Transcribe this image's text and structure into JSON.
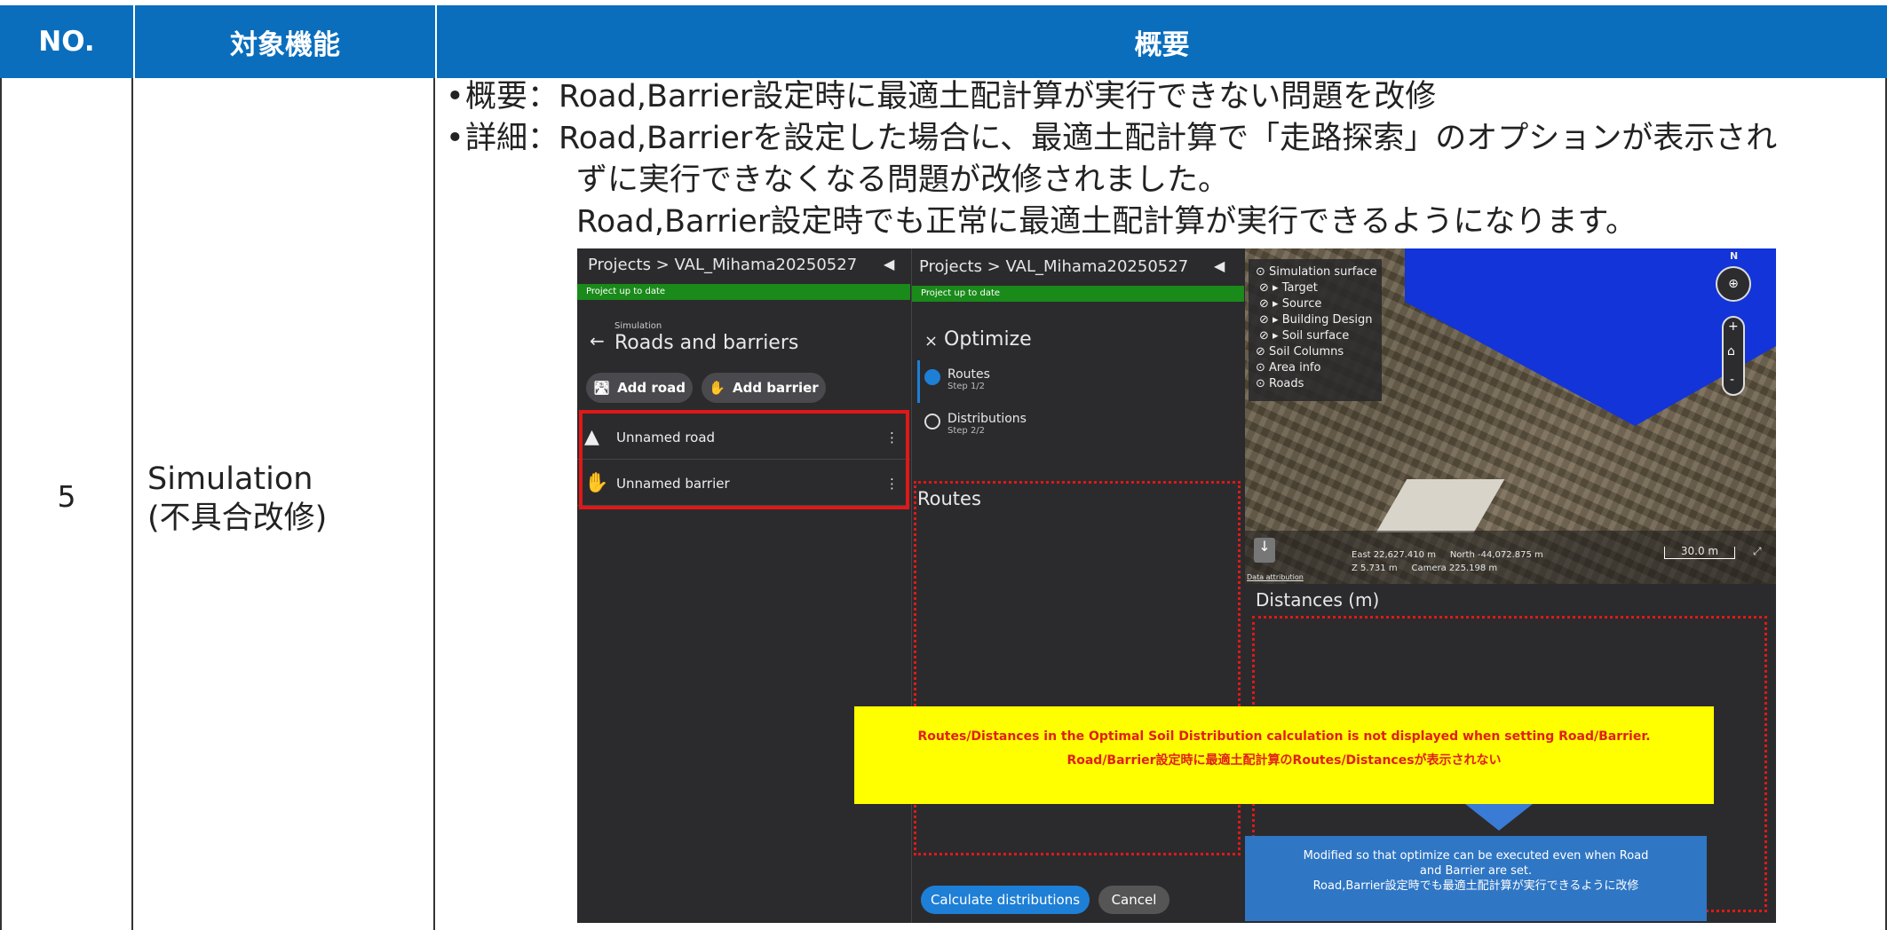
{
  "table": {
    "headers": [
      "NO.",
      "対象機能",
      "概要"
    ],
    "row": {
      "no": "5",
      "feature_line1": "Simulation",
      "feature_line2": "(不具合改修)",
      "summary_label": "概要：",
      "summary_text": "Road,Barrier設定時に最適土配計算が実行できない問題を改修",
      "detail_label": "詳細：",
      "detail_line1": "Road,Barrierを設定した場合に、最適土配計算で「走路探索」のオプションが表示され",
      "detail_line2": "ずに実行できなくなる問題が改修されました。",
      "detail_line3": "Road,Barrier設定時でも正常に最適土配計算が実行できるようになります。"
    }
  },
  "screenshot": {
    "left_panel": {
      "breadcrumb": "Projects > VAL_Mihama20250527",
      "status": "Project up to date",
      "section_small": "Simulation",
      "section_title": "Roads and barriers",
      "add_road": "Add road",
      "add_barrier": "Add barrier",
      "items": [
        "Unnamed road",
        "Unnamed barrier"
      ]
    },
    "middle_panel": {
      "breadcrumb": "Projects > VAL_Mihama20250527",
      "status": "Project up to date",
      "title": "Optimize",
      "steps": [
        {
          "label": "Routes",
          "sub": "Step 1/2"
        },
        {
          "label": "Distributions",
          "sub": "Step 2/2"
        }
      ],
      "routes_heading": "Routes",
      "calc_button": "Calculate distributions",
      "cancel_button": "Cancel"
    },
    "map": {
      "layers": [
        "Simulation surface",
        "Target",
        "Source",
        "Building Design",
        "Soil surface",
        "Soil Columns",
        "Area info",
        "Roads"
      ],
      "compass": "N",
      "coords_line1": "East 22,627.410 m     North -44,072.875 m",
      "coords_line2": "Z 5.731 m     Camera 225.198 m",
      "scale": "30.0 m",
      "attribution": "Data attribution",
      "distances_heading": "Distances (m)"
    },
    "annotations": {
      "yellow_line1": "Routes/Distances in the Optimal Soil Distribution calculation is not displayed when setting Road/Barrier.",
      "yellow_line2": "Road/Barrier設定時に最適土配計算のRoutes/Distancesが表示されない",
      "blue_line1": "Modified so that optimize can be executed even when Road",
      "blue_line2": "and Barrier are set.",
      "blue_line3": "Road,Barrier設定時でも最適土配計算が実行できるように改修"
    }
  }
}
